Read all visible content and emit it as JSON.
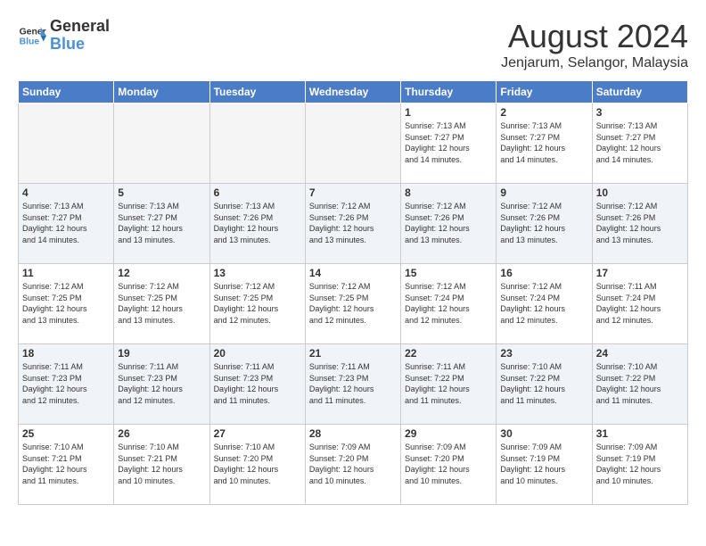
{
  "header": {
    "logo_line1": "General",
    "logo_line2": "Blue",
    "month_title": "August 2024",
    "location": "Jenjarum, Selangor, Malaysia"
  },
  "days_of_week": [
    "Sunday",
    "Monday",
    "Tuesday",
    "Wednesday",
    "Thursday",
    "Friday",
    "Saturday"
  ],
  "weeks": [
    [
      {
        "day": "",
        "info": "",
        "empty": true
      },
      {
        "day": "",
        "info": "",
        "empty": true
      },
      {
        "day": "",
        "info": "",
        "empty": true
      },
      {
        "day": "",
        "info": "",
        "empty": true
      },
      {
        "day": "1",
        "info": "Sunrise: 7:13 AM\nSunset: 7:27 PM\nDaylight: 12 hours\nand 14 minutes."
      },
      {
        "day": "2",
        "info": "Sunrise: 7:13 AM\nSunset: 7:27 PM\nDaylight: 12 hours\nand 14 minutes."
      },
      {
        "day": "3",
        "info": "Sunrise: 7:13 AM\nSunset: 7:27 PM\nDaylight: 12 hours\nand 14 minutes."
      }
    ],
    [
      {
        "day": "4",
        "info": "Sunrise: 7:13 AM\nSunset: 7:27 PM\nDaylight: 12 hours\nand 14 minutes."
      },
      {
        "day": "5",
        "info": "Sunrise: 7:13 AM\nSunset: 7:27 PM\nDaylight: 12 hours\nand 13 minutes."
      },
      {
        "day": "6",
        "info": "Sunrise: 7:13 AM\nSunset: 7:26 PM\nDaylight: 12 hours\nand 13 minutes."
      },
      {
        "day": "7",
        "info": "Sunrise: 7:12 AM\nSunset: 7:26 PM\nDaylight: 12 hours\nand 13 minutes."
      },
      {
        "day": "8",
        "info": "Sunrise: 7:12 AM\nSunset: 7:26 PM\nDaylight: 12 hours\nand 13 minutes."
      },
      {
        "day": "9",
        "info": "Sunrise: 7:12 AM\nSunset: 7:26 PM\nDaylight: 12 hours\nand 13 minutes."
      },
      {
        "day": "10",
        "info": "Sunrise: 7:12 AM\nSunset: 7:26 PM\nDaylight: 12 hours\nand 13 minutes."
      }
    ],
    [
      {
        "day": "11",
        "info": "Sunrise: 7:12 AM\nSunset: 7:25 PM\nDaylight: 12 hours\nand 13 minutes."
      },
      {
        "day": "12",
        "info": "Sunrise: 7:12 AM\nSunset: 7:25 PM\nDaylight: 12 hours\nand 13 minutes."
      },
      {
        "day": "13",
        "info": "Sunrise: 7:12 AM\nSunset: 7:25 PM\nDaylight: 12 hours\nand 12 minutes."
      },
      {
        "day": "14",
        "info": "Sunrise: 7:12 AM\nSunset: 7:25 PM\nDaylight: 12 hours\nand 12 minutes."
      },
      {
        "day": "15",
        "info": "Sunrise: 7:12 AM\nSunset: 7:24 PM\nDaylight: 12 hours\nand 12 minutes."
      },
      {
        "day": "16",
        "info": "Sunrise: 7:12 AM\nSunset: 7:24 PM\nDaylight: 12 hours\nand 12 minutes."
      },
      {
        "day": "17",
        "info": "Sunrise: 7:11 AM\nSunset: 7:24 PM\nDaylight: 12 hours\nand 12 minutes."
      }
    ],
    [
      {
        "day": "18",
        "info": "Sunrise: 7:11 AM\nSunset: 7:23 PM\nDaylight: 12 hours\nand 12 minutes."
      },
      {
        "day": "19",
        "info": "Sunrise: 7:11 AM\nSunset: 7:23 PM\nDaylight: 12 hours\nand 12 minutes."
      },
      {
        "day": "20",
        "info": "Sunrise: 7:11 AM\nSunset: 7:23 PM\nDaylight: 12 hours\nand 11 minutes."
      },
      {
        "day": "21",
        "info": "Sunrise: 7:11 AM\nSunset: 7:23 PM\nDaylight: 12 hours\nand 11 minutes."
      },
      {
        "day": "22",
        "info": "Sunrise: 7:11 AM\nSunset: 7:22 PM\nDaylight: 12 hours\nand 11 minutes."
      },
      {
        "day": "23",
        "info": "Sunrise: 7:10 AM\nSunset: 7:22 PM\nDaylight: 12 hours\nand 11 minutes."
      },
      {
        "day": "24",
        "info": "Sunrise: 7:10 AM\nSunset: 7:22 PM\nDaylight: 12 hours\nand 11 minutes."
      }
    ],
    [
      {
        "day": "25",
        "info": "Sunrise: 7:10 AM\nSunset: 7:21 PM\nDaylight: 12 hours\nand 11 minutes."
      },
      {
        "day": "26",
        "info": "Sunrise: 7:10 AM\nSunset: 7:21 PM\nDaylight: 12 hours\nand 10 minutes."
      },
      {
        "day": "27",
        "info": "Sunrise: 7:10 AM\nSunset: 7:20 PM\nDaylight: 12 hours\nand 10 minutes."
      },
      {
        "day": "28",
        "info": "Sunrise: 7:09 AM\nSunset: 7:20 PM\nDaylight: 12 hours\nand 10 minutes."
      },
      {
        "day": "29",
        "info": "Sunrise: 7:09 AM\nSunset: 7:20 PM\nDaylight: 12 hours\nand 10 minutes."
      },
      {
        "day": "30",
        "info": "Sunrise: 7:09 AM\nSunset: 7:19 PM\nDaylight: 12 hours\nand 10 minutes."
      },
      {
        "day": "31",
        "info": "Sunrise: 7:09 AM\nSunset: 7:19 PM\nDaylight: 12 hours\nand 10 minutes."
      }
    ]
  ]
}
